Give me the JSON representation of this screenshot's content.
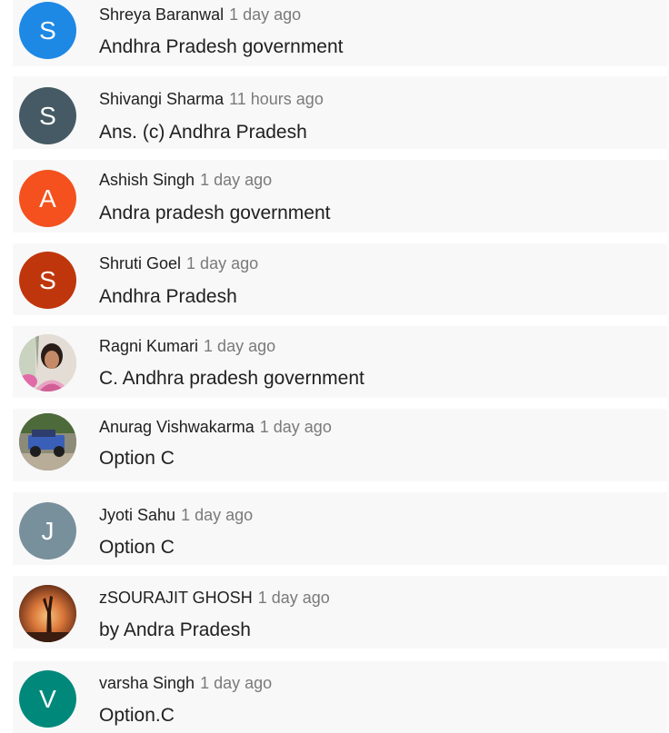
{
  "comments": [
    {
      "author": "Shreya Baranwal",
      "time": "1 day ago",
      "text": "Andhra Pradesh government",
      "avatar": {
        "type": "initial",
        "letter": "S",
        "color": "#1e88e5"
      }
    },
    {
      "author": "Shivangi Sharma",
      "time": "11 hours ago",
      "text": "Ans.  (c) Andhra Pradesh",
      "avatar": {
        "type": "initial",
        "letter": "S",
        "color": "#455a64"
      }
    },
    {
      "author": "Ashish Singh",
      "time": "1 day ago",
      "text": "Andra pradesh government",
      "avatar": {
        "type": "initial",
        "letter": "A",
        "color": "#f4511e"
      }
    },
    {
      "author": "Shruti Goel",
      "time": "1 day ago",
      "text": "Andhra Pradesh",
      "avatar": {
        "type": "initial",
        "letter": "S",
        "color": "#bf360c"
      }
    },
    {
      "author": "Ragni Kumari",
      "time": "1 day ago",
      "text": "C. Andhra pradesh government",
      "avatar": {
        "type": "photo",
        "icon": "person-photo-icon"
      }
    },
    {
      "author": "Anurag Vishwakarma",
      "time": "1 day ago",
      "text": "Option C",
      "avatar": {
        "type": "photo",
        "icon": "jeep-photo-icon"
      }
    },
    {
      "author": "Jyoti Sahu",
      "time": "1 day ago",
      "text": "Option C",
      "avatar": {
        "type": "initial",
        "letter": "J",
        "color": "#78909c"
      }
    },
    {
      "author": "zSOURAJIT GHOSH",
      "time": "1 day ago",
      "text": "by Andra Pradesh",
      "avatar": {
        "type": "photo",
        "icon": "sunset-silhouette-photo-icon"
      }
    },
    {
      "author": "varsha Singh",
      "time": "1 day ago",
      "text": "Option.C",
      "avatar": {
        "type": "initial",
        "letter": "V",
        "color": "#00897b"
      }
    }
  ]
}
